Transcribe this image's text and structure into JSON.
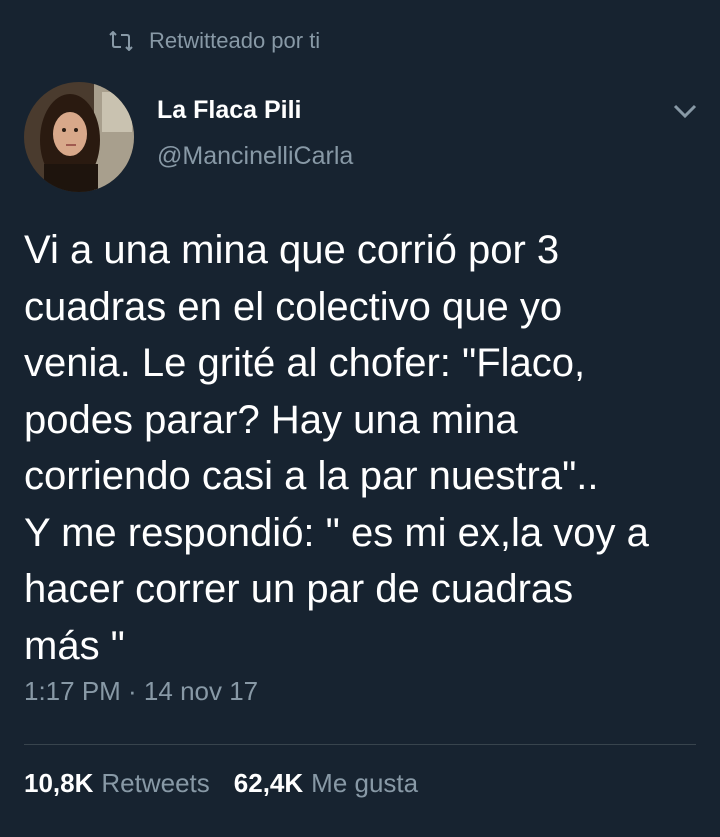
{
  "retweet_banner": {
    "icon": "retweet-icon",
    "text": "Retwitteado por ti"
  },
  "author": {
    "avatar": "avatar",
    "name": "La Flaca Pili",
    "handle": "@MancinelliCarla"
  },
  "menu": {
    "icon": "chevron-down-icon"
  },
  "tweet": {
    "text": "Vi a una mina que corrió por 3\ncuadras en el colectivo que yo\nvenia. Le grité al chofer: \"Flaco,\npodes parar? Hay una mina\ncorriendo casi a la par nuestra\"..\nY me respondió: \" es mi ex,la voy a\nhacer correr un par de cuadras\nmás \"",
    "timestamp": "1:17 PM · 14 nov 17"
  },
  "stats": {
    "retweets_count": "10,8K",
    "retweets_label": "Retweets",
    "likes_count": "62,4K",
    "likes_label": "Me gusta"
  },
  "colors": {
    "background": "#172330",
    "secondary_text": "#8899a6",
    "primary_text": "#ffffff",
    "divider": "#38444d"
  }
}
